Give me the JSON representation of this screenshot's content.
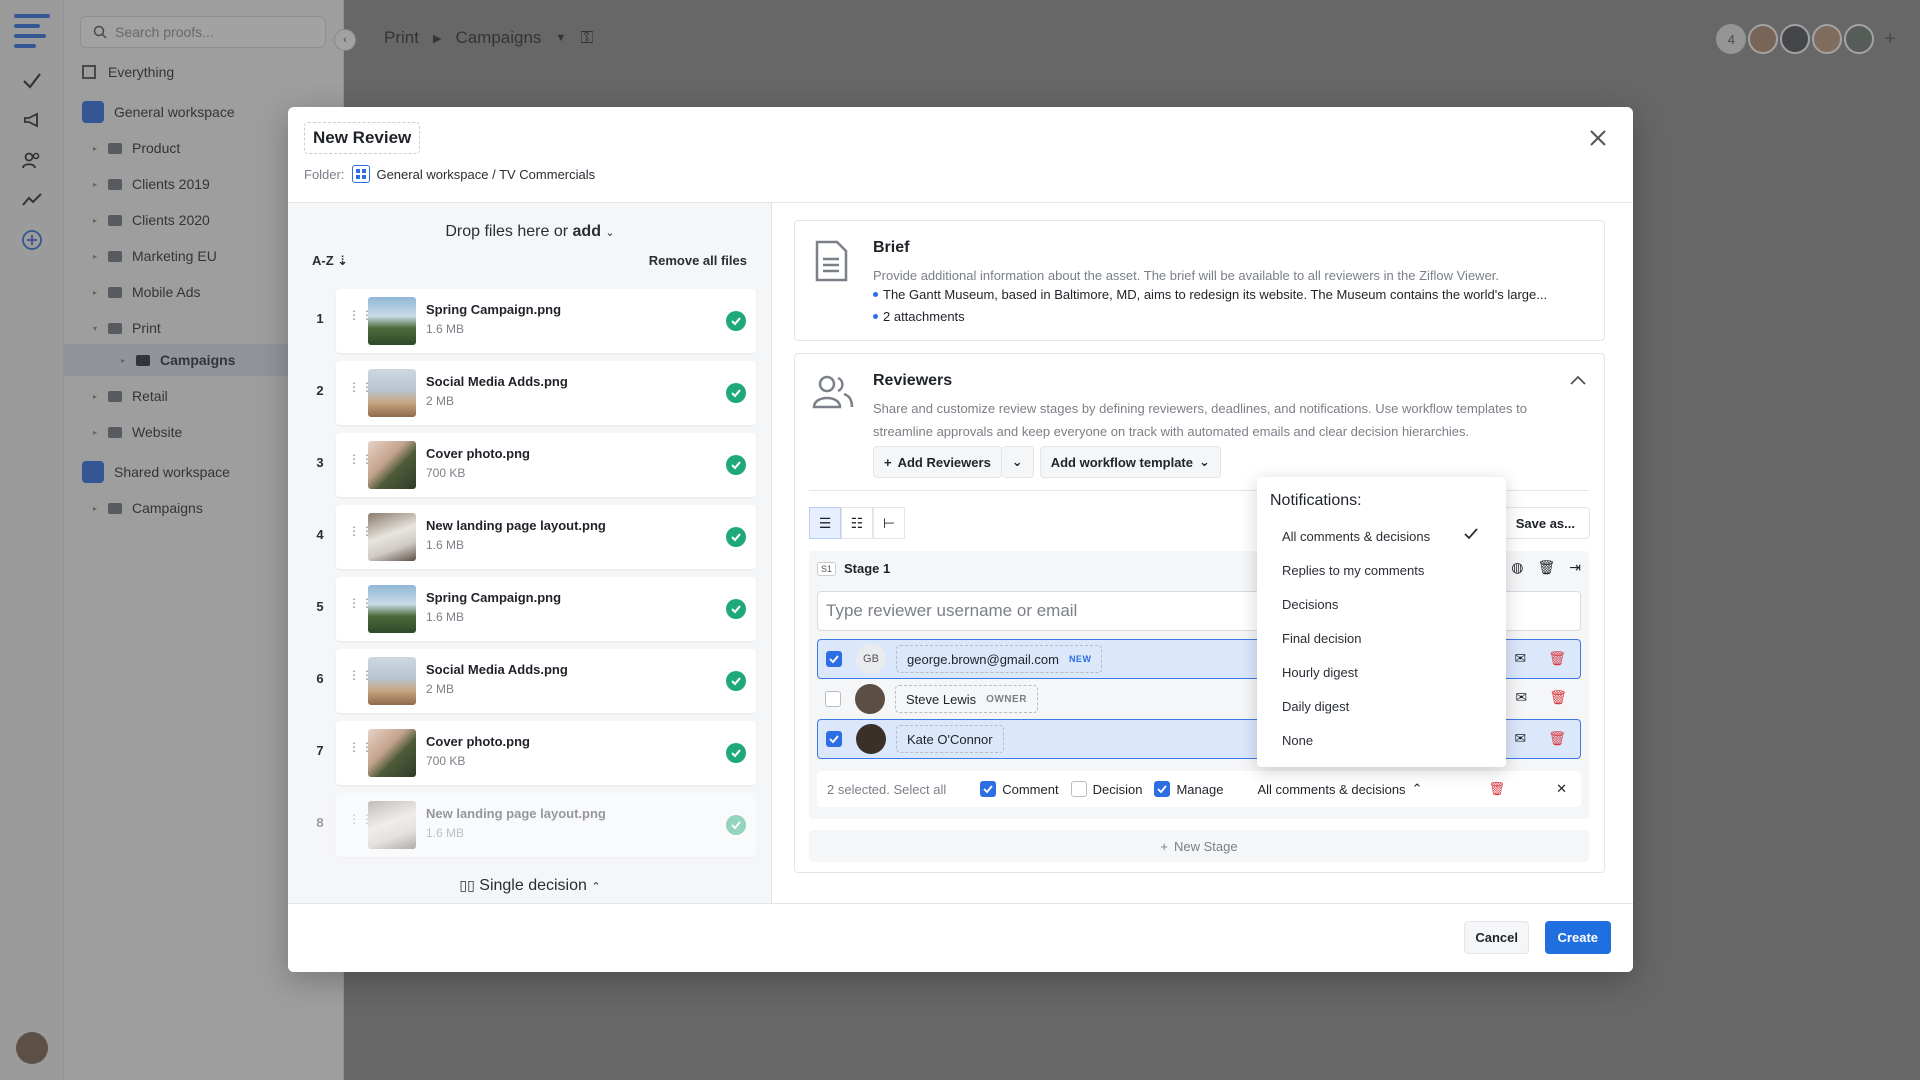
{
  "sidebar": {
    "search_placeholder": "Search proofs...",
    "items": [
      {
        "label": "Everything"
      },
      {
        "label": "General workspace"
      },
      {
        "label": "Product"
      },
      {
        "label": "Clients 2019"
      },
      {
        "label": "Clients 2020"
      },
      {
        "label": "Marketing EU"
      },
      {
        "label": "Mobile Ads"
      },
      {
        "label": "Print"
      },
      {
        "label": "Campaigns"
      },
      {
        "label": "Retail"
      },
      {
        "label": "Website"
      },
      {
        "label": "Shared workspace"
      },
      {
        "label": "Campaigns"
      }
    ]
  },
  "topbar": {
    "crumb1": "Print",
    "crumb2": "Campaigns",
    "member_count": "4"
  },
  "modal": {
    "title": "New Review",
    "folder_label": "Folder:",
    "folder_path": "General workspace / TV Commercials",
    "drop_text": "Drop files here or",
    "drop_add": "add",
    "sort_label": "A-Z",
    "remove_all": "Remove all files",
    "decision_mode": "Single decision",
    "files": [
      {
        "index": "1",
        "name": "Spring Campaign.png",
        "size": "1.6 MB"
      },
      {
        "index": "2",
        "name": "Social Media Adds.png",
        "size": "2 MB"
      },
      {
        "index": "3",
        "name": "Cover photo.png",
        "size": "700 KB"
      },
      {
        "index": "4",
        "name": "New landing page layout.png",
        "size": "1.6 MB"
      },
      {
        "index": "5",
        "name": "Spring Campaign.png",
        "size": "1.6 MB"
      },
      {
        "index": "6",
        "name": "Social Media Adds.png",
        "size": "2 MB"
      },
      {
        "index": "7",
        "name": "Cover photo.png",
        "size": "700 KB"
      },
      {
        "index": "8",
        "name": "New landing page layout.png",
        "size": "1.6 MB"
      }
    ],
    "brief": {
      "title": "Brief",
      "description": "Provide additional information about the asset. The brief will be available to all reviewers in the Ziflow Viewer.",
      "bullet1": "The Gantt Museum, based in Baltimore, MD, aims to redesign its website. The Museum contains the world's large...",
      "bullet2": "2 attachments"
    },
    "reviewers": {
      "title": "Reviewers",
      "description": "Share and customize review stages by defining reviewers, deadlines, and notifications. Use workflow templates to streamline approvals and keep everyone on track with automated emails and clear decision hierarchies.",
      "add_reviewers": "Add Reviewers",
      "add_template": "Add workflow template",
      "save_as": "Save as...",
      "stage_badge": "S1",
      "stage_name": "Stage 1",
      "input_placeholder": "Type reviewer username or email",
      "rows": [
        {
          "initials": "GB",
          "name": "george.brown@gmail.com",
          "tag": "NEW",
          "checked": true
        },
        {
          "initials": "",
          "name": "Steve Lewis",
          "tag": "OWNER",
          "checked": false
        },
        {
          "initials": "",
          "name": "Kate O'Connor",
          "tag": "",
          "checked": true
        }
      ],
      "selection_text": "2 selected. Select all",
      "opt_comment": "Comment",
      "opt_decision": "Decision",
      "opt_manage": "Manage",
      "notif_current": "All comments & decisions",
      "new_stage": "New Stage"
    },
    "cancel": "Cancel",
    "create": "Create"
  },
  "notifications": {
    "title": "Notifications:",
    "options": [
      {
        "label": "All comments & decisions",
        "selected": true
      },
      {
        "label": "Replies to my comments"
      },
      {
        "label": "Decisions"
      },
      {
        "label": "Final decision"
      },
      {
        "label": "Hourly digest"
      },
      {
        "label": "Daily digest"
      },
      {
        "label": "None"
      }
    ]
  },
  "colors": {
    "accent": "#2d6fe3",
    "primary_button": "#1f6fe0",
    "success": "#1fa97a",
    "danger": "#d9363e"
  }
}
